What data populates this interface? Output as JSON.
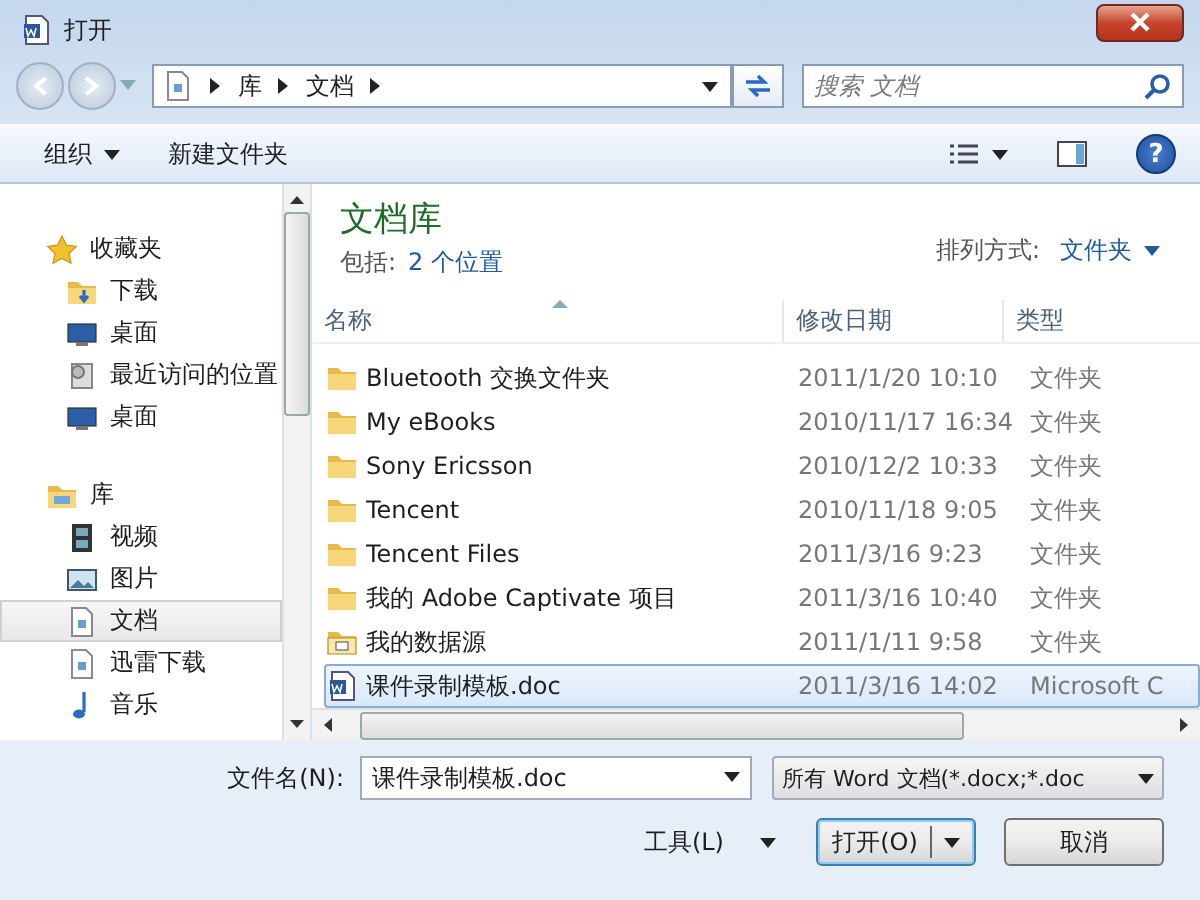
{
  "window": {
    "title": "打开"
  },
  "address": {
    "path": [
      "库",
      "文档"
    ]
  },
  "search": {
    "placeholder": "搜索 文档"
  },
  "toolbar": {
    "organize": "组织",
    "new_folder": "新建文件夹",
    "help": "?"
  },
  "nav": [
    {
      "label": "收藏夹",
      "kind": "favorites",
      "selected": false,
      "children": [
        {
          "label": "下载",
          "kind": "download",
          "selected": false
        },
        {
          "label": "桌面",
          "kind": "desktop",
          "selected": false
        },
        {
          "label": "最近访问的位置",
          "kind": "recent",
          "selected": false
        },
        {
          "label": "桌面",
          "kind": "desktop",
          "selected": false
        }
      ]
    },
    {
      "label": "库",
      "kind": "library",
      "selected": false,
      "children": [
        {
          "label": "视频",
          "kind": "video",
          "selected": false
        },
        {
          "label": "图片",
          "kind": "picture",
          "selected": false
        },
        {
          "label": "文档",
          "kind": "document",
          "selected": true
        },
        {
          "label": "迅雷下载",
          "kind": "document",
          "selected": false
        },
        {
          "label": "音乐",
          "kind": "music",
          "selected": false
        }
      ]
    }
  ],
  "library": {
    "title": "文档库",
    "includes_label": "包括:",
    "includes_link": "2 个位置",
    "arrange_label": "排列方式:",
    "arrange_value": "文件夹"
  },
  "table": {
    "columns": [
      "名称",
      "修改日期",
      "类型"
    ],
    "rows": [
      {
        "name": "Bluetooth 交换文件夹",
        "date": "2011/1/20 10:10",
        "type": "文件夹",
        "kind": "folder",
        "selected": false
      },
      {
        "name": "My eBooks",
        "date": "2010/11/17 16:34",
        "type": "文件夹",
        "kind": "folder",
        "selected": false
      },
      {
        "name": "Sony Ericsson",
        "date": "2010/12/2 10:33",
        "type": "文件夹",
        "kind": "folder",
        "selected": false
      },
      {
        "name": "Tencent",
        "date": "2010/11/18 9:05",
        "type": "文件夹",
        "kind": "folder",
        "selected": false
      },
      {
        "name": "Tencent Files",
        "date": "2011/3/16 9:23",
        "type": "文件夹",
        "kind": "folder",
        "selected": false
      },
      {
        "name": "我的 Adobe Captivate 项目",
        "date": "2011/3/16 10:40",
        "type": "文件夹",
        "kind": "folder",
        "selected": false
      },
      {
        "name": "我的数据源",
        "date": "2011/1/11 9:58",
        "type": "文件夹",
        "kind": "datasource",
        "selected": false
      },
      {
        "name": "课件录制模板.doc",
        "date": "2011/3/16 14:02",
        "type": "Microsoft C",
        "kind": "doc",
        "selected": true
      }
    ]
  },
  "footer": {
    "filename_label": "文件名(N):",
    "filename": "课件录制模板.doc",
    "filter": "所有 Word 文档(*.docx;*.doc",
    "tools": "工具(L)",
    "open": "打开(O)",
    "cancel": "取消"
  }
}
